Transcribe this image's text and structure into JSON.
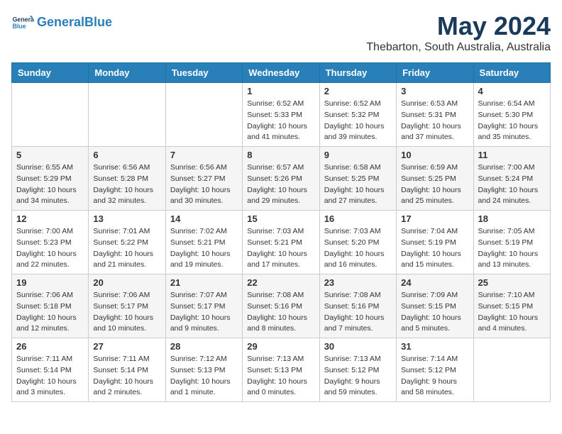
{
  "logo": {
    "text_general": "General",
    "text_blue": "Blue"
  },
  "header": {
    "month_year": "May 2024",
    "location": "Thebarton, South Australia, Australia"
  },
  "days_of_week": [
    "Sunday",
    "Monday",
    "Tuesday",
    "Wednesday",
    "Thursday",
    "Friday",
    "Saturday"
  ],
  "weeks": [
    [
      {
        "day": "",
        "info": ""
      },
      {
        "day": "",
        "info": ""
      },
      {
        "day": "",
        "info": ""
      },
      {
        "day": "1",
        "info": "Sunrise: 6:52 AM\nSunset: 5:33 PM\nDaylight: 10 hours\nand 41 minutes."
      },
      {
        "day": "2",
        "info": "Sunrise: 6:52 AM\nSunset: 5:32 PM\nDaylight: 10 hours\nand 39 minutes."
      },
      {
        "day": "3",
        "info": "Sunrise: 6:53 AM\nSunset: 5:31 PM\nDaylight: 10 hours\nand 37 minutes."
      },
      {
        "day": "4",
        "info": "Sunrise: 6:54 AM\nSunset: 5:30 PM\nDaylight: 10 hours\nand 35 minutes."
      }
    ],
    [
      {
        "day": "5",
        "info": "Sunrise: 6:55 AM\nSunset: 5:29 PM\nDaylight: 10 hours\nand 34 minutes."
      },
      {
        "day": "6",
        "info": "Sunrise: 6:56 AM\nSunset: 5:28 PM\nDaylight: 10 hours\nand 32 minutes."
      },
      {
        "day": "7",
        "info": "Sunrise: 6:56 AM\nSunset: 5:27 PM\nDaylight: 10 hours\nand 30 minutes."
      },
      {
        "day": "8",
        "info": "Sunrise: 6:57 AM\nSunset: 5:26 PM\nDaylight: 10 hours\nand 29 minutes."
      },
      {
        "day": "9",
        "info": "Sunrise: 6:58 AM\nSunset: 5:25 PM\nDaylight: 10 hours\nand 27 minutes."
      },
      {
        "day": "10",
        "info": "Sunrise: 6:59 AM\nSunset: 5:25 PM\nDaylight: 10 hours\nand 25 minutes."
      },
      {
        "day": "11",
        "info": "Sunrise: 7:00 AM\nSunset: 5:24 PM\nDaylight: 10 hours\nand 24 minutes."
      }
    ],
    [
      {
        "day": "12",
        "info": "Sunrise: 7:00 AM\nSunset: 5:23 PM\nDaylight: 10 hours\nand 22 minutes."
      },
      {
        "day": "13",
        "info": "Sunrise: 7:01 AM\nSunset: 5:22 PM\nDaylight: 10 hours\nand 21 minutes."
      },
      {
        "day": "14",
        "info": "Sunrise: 7:02 AM\nSunset: 5:21 PM\nDaylight: 10 hours\nand 19 minutes."
      },
      {
        "day": "15",
        "info": "Sunrise: 7:03 AM\nSunset: 5:21 PM\nDaylight: 10 hours\nand 17 minutes."
      },
      {
        "day": "16",
        "info": "Sunrise: 7:03 AM\nSunset: 5:20 PM\nDaylight: 10 hours\nand 16 minutes."
      },
      {
        "day": "17",
        "info": "Sunrise: 7:04 AM\nSunset: 5:19 PM\nDaylight: 10 hours\nand 15 minutes."
      },
      {
        "day": "18",
        "info": "Sunrise: 7:05 AM\nSunset: 5:19 PM\nDaylight: 10 hours\nand 13 minutes."
      }
    ],
    [
      {
        "day": "19",
        "info": "Sunrise: 7:06 AM\nSunset: 5:18 PM\nDaylight: 10 hours\nand 12 minutes."
      },
      {
        "day": "20",
        "info": "Sunrise: 7:06 AM\nSunset: 5:17 PM\nDaylight: 10 hours\nand 10 minutes."
      },
      {
        "day": "21",
        "info": "Sunrise: 7:07 AM\nSunset: 5:17 PM\nDaylight: 10 hours\nand 9 minutes."
      },
      {
        "day": "22",
        "info": "Sunrise: 7:08 AM\nSunset: 5:16 PM\nDaylight: 10 hours\nand 8 minutes."
      },
      {
        "day": "23",
        "info": "Sunrise: 7:08 AM\nSunset: 5:16 PM\nDaylight: 10 hours\nand 7 minutes."
      },
      {
        "day": "24",
        "info": "Sunrise: 7:09 AM\nSunset: 5:15 PM\nDaylight: 10 hours\nand 5 minutes."
      },
      {
        "day": "25",
        "info": "Sunrise: 7:10 AM\nSunset: 5:15 PM\nDaylight: 10 hours\nand 4 minutes."
      }
    ],
    [
      {
        "day": "26",
        "info": "Sunrise: 7:11 AM\nSunset: 5:14 PM\nDaylight: 10 hours\nand 3 minutes."
      },
      {
        "day": "27",
        "info": "Sunrise: 7:11 AM\nSunset: 5:14 PM\nDaylight: 10 hours\nand 2 minutes."
      },
      {
        "day": "28",
        "info": "Sunrise: 7:12 AM\nSunset: 5:13 PM\nDaylight: 10 hours\nand 1 minute."
      },
      {
        "day": "29",
        "info": "Sunrise: 7:13 AM\nSunset: 5:13 PM\nDaylight: 10 hours\nand 0 minutes."
      },
      {
        "day": "30",
        "info": "Sunrise: 7:13 AM\nSunset: 5:12 PM\nDaylight: 9 hours\nand 59 minutes."
      },
      {
        "day": "31",
        "info": "Sunrise: 7:14 AM\nSunset: 5:12 PM\nDaylight: 9 hours\nand 58 minutes."
      },
      {
        "day": "",
        "info": ""
      }
    ]
  ]
}
